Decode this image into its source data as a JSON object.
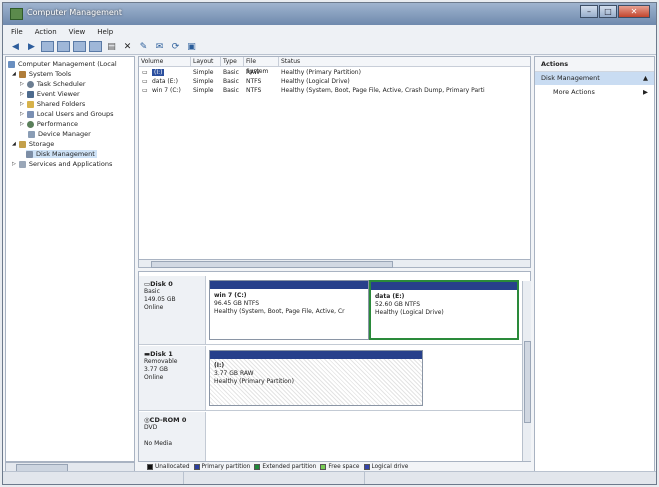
{
  "window": {
    "title": "Computer Management",
    "minimize": "–",
    "maximize": "□",
    "close": "✕"
  },
  "menu": [
    "File",
    "Action",
    "View",
    "Help"
  ],
  "tree": {
    "root": "Computer Management (Local",
    "system_tools": "System Tools",
    "task_scheduler": "Task Scheduler",
    "event_viewer": "Event Viewer",
    "shared_folders": "Shared Folders",
    "local_users": "Local Users and Groups",
    "performance": "Performance",
    "device_manager": "Device Manager",
    "storage": "Storage",
    "disk_management": "Disk Management",
    "services": "Services and Applications"
  },
  "volumes": {
    "headers": [
      "Volume",
      "Layout",
      "Type",
      "File System",
      "Status"
    ],
    "rows": [
      [
        "(I:)",
        "Simple",
        "Basic",
        "RAW",
        "Healthy (Primary Partition)"
      ],
      [
        "data (E:)",
        "Simple",
        "Basic",
        "NTFS",
        "Healthy (Logical Drive)"
      ],
      [
        "win 7 (C:)",
        "Simple",
        "Basic",
        "NTFS",
        "Healthy (System, Boot, Page File, Active, Crash Dump, Primary Parti"
      ]
    ]
  },
  "disks": {
    "disk0": {
      "name": "Disk 0",
      "kind": "Basic",
      "size": "149.05 GB",
      "state": "Online"
    },
    "disk0_p1": {
      "name": "win 7 (C:)",
      "size": "96.45 GB NTFS",
      "status": "Healthy (System, Boot, Page File, Active, Cr"
    },
    "disk0_p2": {
      "name": "data (E:)",
      "size": "52.60 GB NTFS",
      "status": "Healthy (Logical Drive)"
    },
    "disk1": {
      "name": "Disk 1",
      "kind": "Removable",
      "size": "3.77 GB",
      "state": "Online"
    },
    "disk1_p1": {
      "name": "(I:)",
      "size": "3.77 GB RAW",
      "status": "Healthy (Primary Partition)"
    },
    "cdrom": {
      "name": "CD-ROM 0",
      "kind": "DVD",
      "state": "No Media"
    }
  },
  "legend": [
    {
      "label": "Unallocated",
      "color": "#111111"
    },
    {
      "label": "Primary partition",
      "color": "#2b3fa0"
    },
    {
      "label": "Extended partition",
      "color": "#1f8a3a"
    },
    {
      "label": "Free space",
      "color": "#77cc55"
    },
    {
      "label": "Logical drive",
      "color": "#3344aa"
    }
  ],
  "actions": {
    "header": "Actions",
    "section": "Disk Management",
    "more": "More Actions"
  },
  "colors": {
    "accent": "#27408b",
    "selection_border": "#2a8a3a"
  }
}
